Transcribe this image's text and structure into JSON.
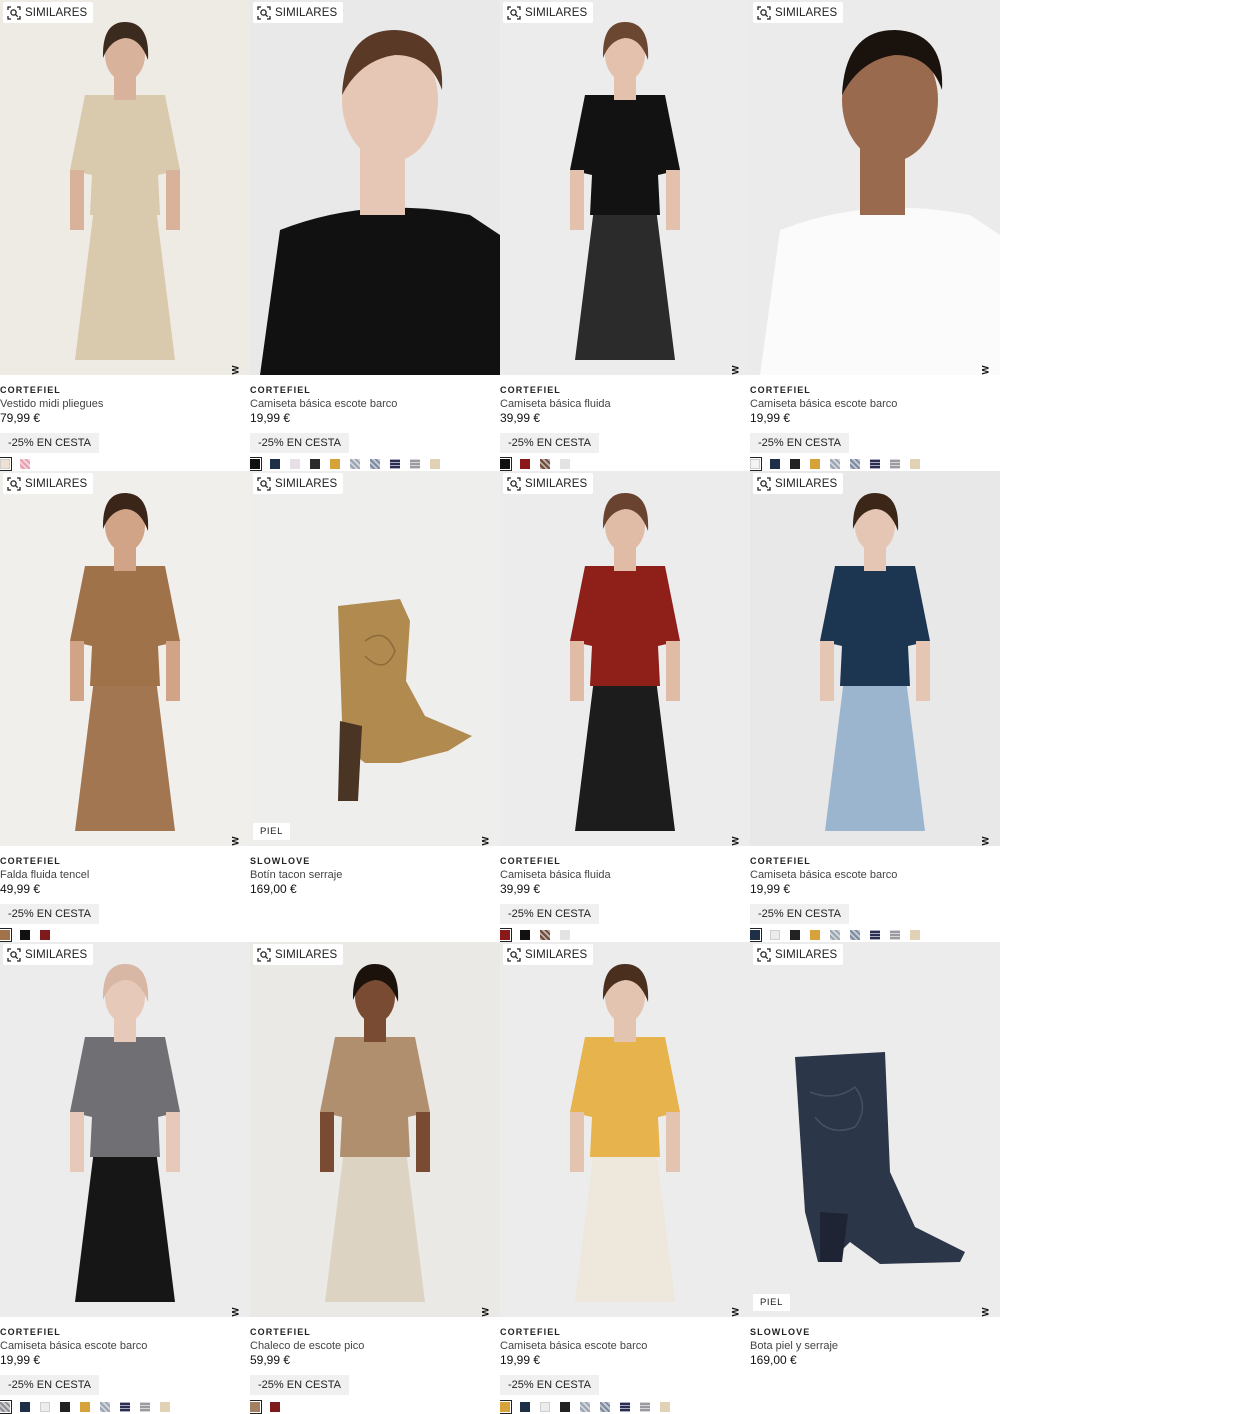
{
  "similar_label": "SIMILARES",
  "new_label": "NEW",
  "products": [
    {
      "brand": "CORTEFIEL",
      "name": "Vestido midi pliegues",
      "price": "79,99 €",
      "promo": "-25% EN CESTA",
      "badge": "",
      "bg": "#eeeae4",
      "garment": "#d9c9ad",
      "skin": "#d8b29a",
      "hair": "#3b2a1e",
      "lower": "#d9c9ad",
      "swatches": [
        {
          "c": "#efe1cf"
        },
        {
          "c": "#e8a0b0",
          "p": "pattern"
        }
      ]
    },
    {
      "brand": "CORTEFIEL",
      "name": "Camiseta básica escote barco",
      "price": "19,99 €",
      "promo": "-25% EN CESTA",
      "badge": "",
      "bg": "#e9e9ea",
      "garment": "#111111",
      "skin": "#e6c7b6",
      "hair": "#5a3a26",
      "lower": "#111111",
      "swatches": [
        {
          "c": "#111111"
        },
        {
          "c": "#1e2f48"
        },
        {
          "c": "#e6e0e6"
        },
        {
          "c": "#2a2a2a"
        },
        {
          "c": "#d5a33a"
        },
        {
          "c": "#9aa4b0",
          "p": "pattern"
        },
        {
          "c": "#7d8aa0",
          "p": "pattern"
        },
        {
          "c": "#2c2d55",
          "p": "stripe"
        },
        {
          "c": "#9a9aa0",
          "p": "stripe"
        },
        {
          "c": "#e2d2b5"
        }
      ]
    },
    {
      "brand": "CORTEFIEL",
      "name": "Camiseta básica fluida",
      "price": "39,99 €",
      "promo": "-25% EN CESTA",
      "badge": "",
      "bg": "#ececec",
      "garment": "#121212",
      "skin": "#e3c1ad",
      "hair": "#6b4630",
      "lower": "#2b2b2b",
      "swatches": [
        {
          "c": "#111111"
        },
        {
          "c": "#8a1a1a"
        },
        {
          "c": "#6b4a3a",
          "p": "pattern"
        },
        {
          "c": "#e3e3e6"
        }
      ]
    },
    {
      "brand": "CORTEFIEL",
      "name": "Camiseta básica escote barco",
      "price": "19,99 €",
      "promo": "-25% EN CESTA",
      "badge": "",
      "bg": "#ebebec",
      "garment": "#fbfbfb",
      "skin": "#9a6a4e",
      "hair": "#1a120d",
      "lower": "#fbfbfb",
      "swatches": [
        {
          "c": "#f3f3f3"
        },
        {
          "c": "#1e2f48"
        },
        {
          "c": "#222222"
        },
        {
          "c": "#d5a33a"
        },
        {
          "c": "#9aa4b0",
          "p": "pattern"
        },
        {
          "c": "#7d8aa0",
          "p": "pattern"
        },
        {
          "c": "#2c2d55",
          "p": "stripe"
        },
        {
          "c": "#9a9aa0",
          "p": "stripe"
        },
        {
          "c": "#e2d2b5"
        }
      ]
    },
    {
      "brand": "CORTEFIEL",
      "name": "Falda fluida tencel",
      "price": "49,99 €",
      "promo": "-25% EN CESTA",
      "badge": "",
      "bg": "#f1efec",
      "garment": "#a0724a",
      "skin": "#d2a487",
      "hair": "#3a2518",
      "lower": "#a27650",
      "swatches": [
        {
          "c": "#a2734a"
        },
        {
          "c": "#111111"
        },
        {
          "c": "#7e1a1c"
        }
      ]
    },
    {
      "brand": "SLOWLOVE",
      "name": "Botín tacon serraje",
      "price": "169,00 €",
      "promo": "",
      "badge": "PIEL",
      "bg": "#eeeeed",
      "garment": "#b08a4f",
      "skin": "",
      "hair": "",
      "lower": "#4a3424",
      "swatches": []
    },
    {
      "brand": "CORTEFIEL",
      "name": "Camiseta básica fluida",
      "price": "39,99 €",
      "promo": "-25% EN CESTA",
      "badge": "",
      "bg": "#ececed",
      "garment": "#8f1f19",
      "skin": "#e0bca6",
      "hair": "#6a4330",
      "lower": "#1c1c1c",
      "swatches": [
        {
          "c": "#8a1a1a"
        },
        {
          "c": "#111111"
        },
        {
          "c": "#6b4a3a",
          "p": "pattern"
        },
        {
          "c": "#e3e3e6"
        }
      ]
    },
    {
      "brand": "CORTEFIEL",
      "name": "Camiseta básica escote barco",
      "price": "19,99 €",
      "promo": "-25% EN CESTA",
      "badge": "",
      "bg": "#e8e8e9",
      "garment": "#1c3550",
      "skin": "#e5c6b4",
      "hair": "#3b2618",
      "lower": "#9cb5cf",
      "swatches": [
        {
          "c": "#1e2f48"
        },
        {
          "c": "#ececec"
        },
        {
          "c": "#222222"
        },
        {
          "c": "#d5a33a"
        },
        {
          "c": "#9aa4b0",
          "p": "pattern"
        },
        {
          "c": "#7d8aa0",
          "p": "pattern"
        },
        {
          "c": "#2c2d55",
          "p": "stripe"
        },
        {
          "c": "#9a9aa0",
          "p": "stripe"
        },
        {
          "c": "#e2d2b5"
        }
      ]
    },
    {
      "brand": "CORTEFIEL",
      "name": "Camiseta básica escote barco",
      "price": "19,99 €",
      "promo": "-25% EN CESTA",
      "badge": "",
      "bg": "#ececec",
      "garment": "#6f6f74",
      "skin": "#e6c9b8",
      "hair": "#d8b7a5",
      "lower": "#161616",
      "swatches": [
        {
          "c": "#8d8d95",
          "p": "pattern"
        },
        {
          "c": "#1e2f48"
        },
        {
          "c": "#ececec"
        },
        {
          "c": "#222222"
        },
        {
          "c": "#d5a33a"
        },
        {
          "c": "#9aa4b0",
          "p": "pattern"
        },
        {
          "c": "#2c2d55",
          "p": "stripe"
        },
        {
          "c": "#9a9aa0",
          "p": "stripe"
        },
        {
          "c": "#e2d2b5"
        }
      ]
    },
    {
      "brand": "CORTEFIEL",
      "name": "Chaleco de escote pico",
      "price": "59,99 €",
      "promo": "-25% EN CESTA",
      "badge": "",
      "bg": "#ebe9e6",
      "garment": "#b08f6e",
      "skin": "#7a4b33",
      "hair": "#1b120c",
      "lower": "#ddd3c3",
      "swatches": [
        {
          "c": "#a48062"
        },
        {
          "c": "#7e1a1c"
        }
      ]
    },
    {
      "brand": "CORTEFIEL",
      "name": "Camiseta básica escote barco",
      "price": "19,99 €",
      "promo": "-25% EN CESTA",
      "badge": "",
      "bg": "#ececec",
      "garment": "#e6b34c",
      "skin": "#e3c4b1",
      "hair": "#4a2f1e",
      "lower": "#ede7dc",
      "swatches": [
        {
          "c": "#d5a33a"
        },
        {
          "c": "#1e2f48"
        },
        {
          "c": "#ececec"
        },
        {
          "c": "#222222"
        },
        {
          "c": "#9aa4b0",
          "p": "pattern"
        },
        {
          "c": "#7d8aa0",
          "p": "pattern"
        },
        {
          "c": "#2c2d55",
          "p": "stripe"
        },
        {
          "c": "#9a9aa0",
          "p": "stripe"
        },
        {
          "c": "#e2d2b5"
        }
      ]
    },
    {
      "brand": "SLOWLOVE",
      "name": "Bota piel y serraje",
      "price": "169,00 €",
      "promo": "",
      "badge": "PIEL",
      "bg": "#ececec",
      "garment": "#2c3649",
      "skin": "",
      "hair": "",
      "lower": "#1e2433",
      "swatches": []
    }
  ]
}
